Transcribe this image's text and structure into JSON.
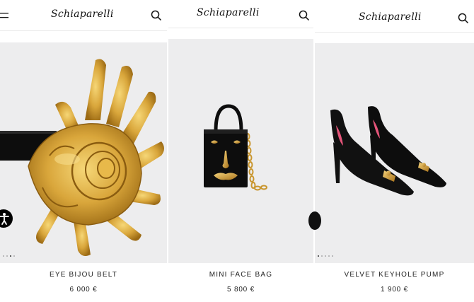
{
  "brand": {
    "logo_text": "Schiaparelli"
  },
  "products": [
    {
      "name": "EYE BIJOU BELT",
      "price": "6 000 €"
    },
    {
      "name": "MINI FACE BAG",
      "price": "5 800 €"
    },
    {
      "name": "VELVET KEYHOLE PUMP",
      "price": "1 900 €"
    }
  ],
  "colors": {
    "gold": "#c9962e",
    "black": "#0d0d0d",
    "image_bg": "#ededee"
  },
  "icons": [
    "menu-icon",
    "search-icon",
    "accessibility-icon"
  ]
}
